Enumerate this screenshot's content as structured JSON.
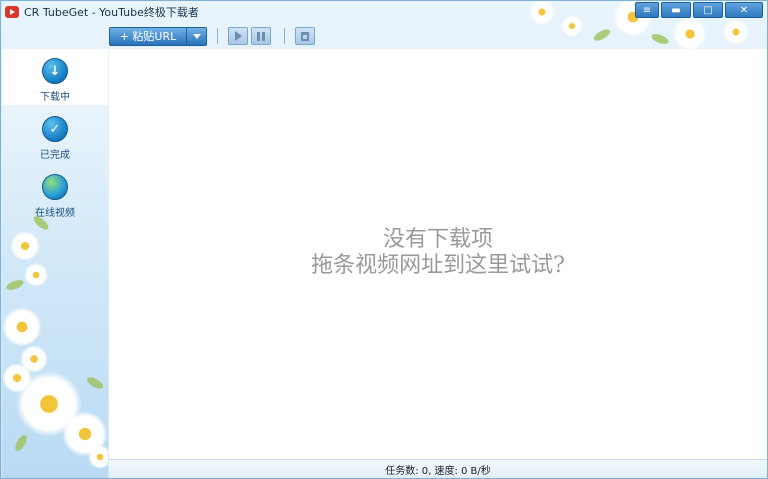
{
  "window": {
    "title": "CR TubeGet - YouTube终极下载者",
    "controls": {
      "menu_icon": "menu-icon",
      "minimize_icon": "minimize-icon",
      "maximize_icon": "maximize-icon",
      "close_icon": "close-icon"
    }
  },
  "toolbar": {
    "paste_label": "+ 粘贴URL",
    "buttons": [
      {
        "icon": "play-icon"
      },
      {
        "icon": "pause-icon"
      },
      {
        "icon": "delete-icon"
      }
    ]
  },
  "sidebar": {
    "items": [
      {
        "label": "下载中",
        "icon": "download-icon",
        "active": true
      },
      {
        "label": "已完成",
        "icon": "check-icon",
        "active": false
      },
      {
        "label": "在线视频",
        "icon": "globe-icon",
        "active": false
      }
    ]
  },
  "main": {
    "empty_line1": "没有下载项",
    "empty_line2": "拖条视频网址到这里试试?"
  },
  "status": {
    "text": "任务数: 0, 速度: 0 B/秒"
  },
  "colors": {
    "accent": "#2a73ba",
    "frame": "#7fb0d8",
    "empty_text": "#9a9a9a",
    "nav_label": "#1b4f80"
  }
}
